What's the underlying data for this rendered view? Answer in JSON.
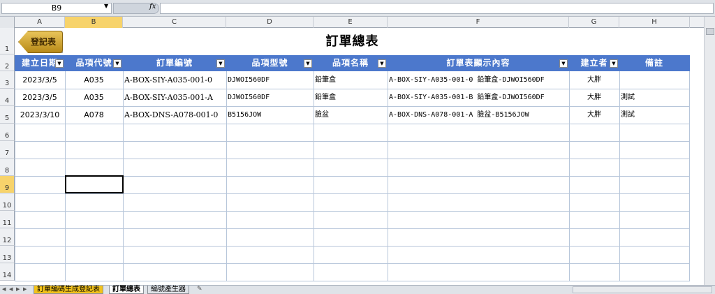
{
  "name_box": "B9",
  "fx_label": "fx",
  "columns": [
    "A",
    "B",
    "C",
    "D",
    "E",
    "F",
    "G",
    "H"
  ],
  "rows": [
    "1",
    "2",
    "3",
    "4",
    "5",
    "6",
    "7",
    "8",
    "9",
    "10",
    "11",
    "12",
    "13",
    "14"
  ],
  "sheet": {
    "title": "訂單總表",
    "register_button": "登記表",
    "headers": [
      "建立日期",
      "品項代號",
      "訂單編號",
      "品項型號",
      "品項名稱",
      "訂單表顯示內容",
      "建立者",
      "備註"
    ],
    "data": [
      [
        "2023/3/5",
        "A035",
        "A-BOX-SIY-A035-001-0",
        "DJWOI560DF",
        "鉛筆盒",
        "A-BOX-SIY-A035-001-0 鉛筆盒-DJWOI560DF",
        "大胖",
        ""
      ],
      [
        "2023/3/5",
        "A035",
        "A-BOX-SIY-A035-001-A",
        "DJWOI560DF",
        "鉛筆盒",
        "A-BOX-SIY-A035-001-B 鉛筆盒-DJWOI560DF",
        "大胖",
        "測試"
      ],
      [
        "2023/3/10",
        "A078",
        "A-BOX-DNS-A078-001-0",
        "B5156JOW",
        "臉盆",
        "A-BOX-DNS-A078-001-A 臉盆-B5156JOW",
        "大胖",
        "測試"
      ]
    ]
  },
  "tabs": [
    {
      "label": "訂單編碼生成登記表",
      "active": false,
      "color": "#f2c21b"
    },
    {
      "label": "訂單總表",
      "active": true,
      "color": "#ffffff"
    },
    {
      "label": "編號產生器",
      "active": false,
      "color": "#dfe3e8"
    }
  ],
  "colors": {
    "header_fill": "#4c78cc",
    "selected_header": "#f7d36b",
    "button_gold": "#d4a52a"
  }
}
